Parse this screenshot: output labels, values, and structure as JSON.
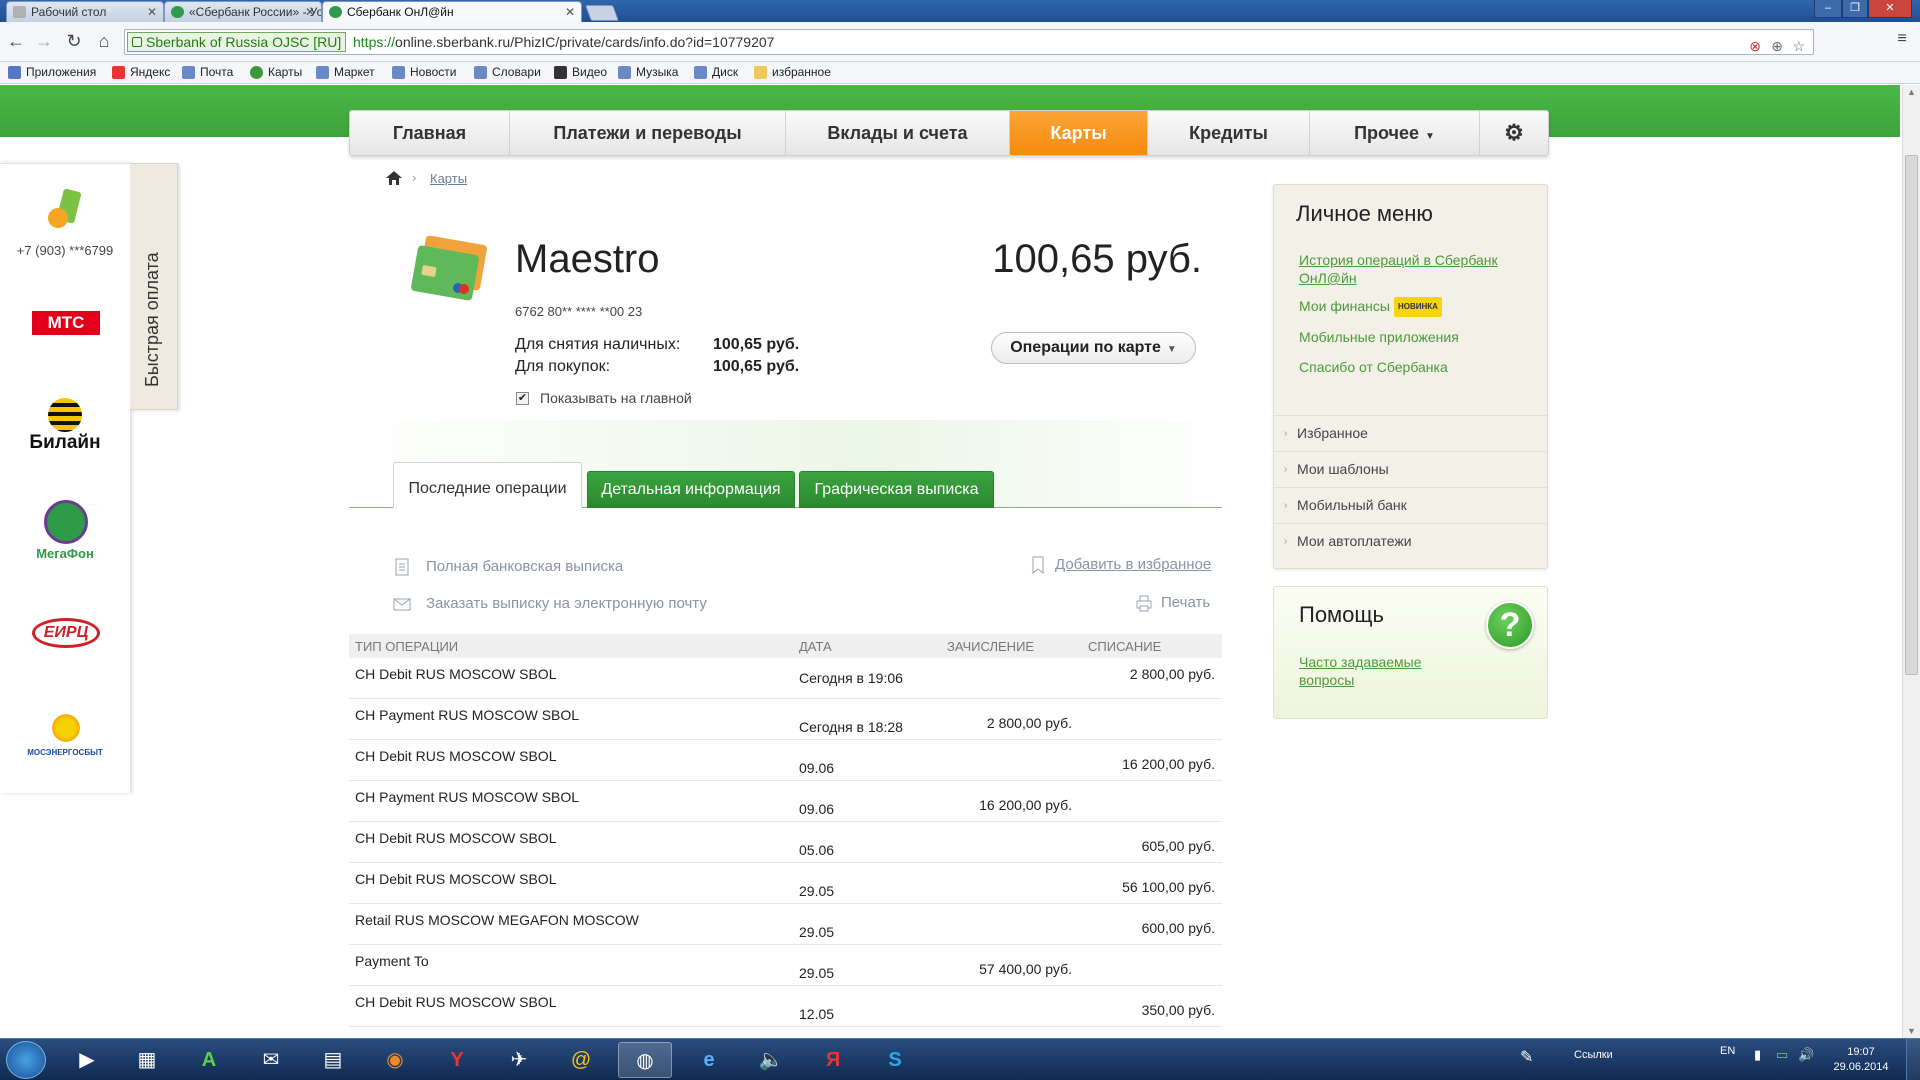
{
  "browser": {
    "tabs": [
      {
        "title": "Рабочий стол",
        "color": "#b0b0b0"
      },
      {
        "title": "«Сбербанк России» - Ус",
        "color": "#2e9b4a"
      },
      {
        "title": "Сбербанк ОнЛ@йн",
        "color": "#2e9b4a"
      }
    ],
    "ev_label": "Sberbank of Russia OJSC [RU]",
    "url_proto": "https://",
    "url_rest": "online.sberbank.ru/PhizIC/private/cards/info.do?id=10779207",
    "bookmarks": [
      "Приложения",
      "Яндекс",
      "Почта",
      "Карты",
      "Маркет",
      "Новости",
      "Словари",
      "Видео",
      "Музыка",
      "Диск",
      "избранное"
    ]
  },
  "nav": {
    "items": [
      "Главная",
      "Платежи и переводы",
      "Вклады и счета",
      "Карты",
      "Кредиты",
      "Прочее"
    ],
    "active": "Карты",
    "accent": "#f68a0c"
  },
  "quickpay": {
    "label": "Быстрая оплата",
    "phone": "+7 (903) ***6799",
    "providers": [
      "МТС",
      "Билайн",
      "МегаФон",
      "ЕИРЦ",
      "МОСЭНЕРГОСБЫТ"
    ]
  },
  "breadcrumb": {
    "current": "Карты"
  },
  "card": {
    "name": "Maestro",
    "balance": "100,65 руб.",
    "number": "6762 80** **** **00 23",
    "cash_label": "Для снятия наличных:",
    "cash_value": "100,65 руб.",
    "purchase_label": "Для покупок:",
    "purchase_value": "100,65 руб.",
    "show_main": "Показывать на главной",
    "show_main_checked": true,
    "ops_button": "Операции по карте"
  },
  "tabs": [
    "Последние операции",
    "Детальная информация",
    "Графическая выписка"
  ],
  "links": {
    "statement": "Полная банковская выписка",
    "email": "Заказать выписку на электронную почту",
    "favorite": "Добавить в избранное",
    "print": "Печать"
  },
  "table": {
    "headers": [
      "ТИП ОПЕРАЦИИ",
      "ДАТА",
      "ЗАЧИСЛЕНИЕ",
      "СПИСАНИЕ"
    ],
    "rows": [
      {
        "op": "CH Debit RUS MOSCOW SBOL",
        "date": "Сегодня в 19:06",
        "credit": "",
        "debit": "2 800,00 руб."
      },
      {
        "op": "CH Payment RUS MOSCOW SBOL",
        "date": "Сегодня в 18:28",
        "credit": "2 800,00 руб.",
        "debit": ""
      },
      {
        "op": "CH Debit RUS MOSCOW SBOL",
        "date": "09.06",
        "credit": "",
        "debit": "16 200,00 руб."
      },
      {
        "op": "CH Payment RUS MOSCOW SBOL",
        "date": "09.06",
        "credit": "16 200,00 руб.",
        "debit": ""
      },
      {
        "op": "CH Debit RUS MOSCOW SBOL",
        "date": "05.06",
        "credit": "",
        "debit": "605,00 руб."
      },
      {
        "op": "CH Debit RUS MOSCOW SBOL",
        "date": "29.05",
        "credit": "",
        "debit": "56 100,00 руб."
      },
      {
        "op": "Retail RUS MOSCOW MEGAFON MOSCOW",
        "date": "29.05",
        "credit": "",
        "debit": "600,00 руб."
      },
      {
        "op": "Payment To",
        "date": "29.05",
        "credit": "57 400,00 руб.",
        "debit": ""
      },
      {
        "op": "CH Debit RUS MOSCOW SBOL",
        "date": "12.05",
        "credit": "",
        "debit": "350,00 руб."
      }
    ]
  },
  "personal_menu": {
    "title": "Личное меню",
    "links": [
      "История операций в Сбербанк ОнЛ@йн",
      "Мои финансы",
      "Мобильные приложения",
      "Спасибо от Сбербанка"
    ],
    "new_badge": "НОВИНКА",
    "items": [
      "Избранное",
      "Мои шаблоны",
      "Мобильный банк",
      "Мои автоплатежи"
    ]
  },
  "help": {
    "title": "Помощь",
    "faq": "Часто задаваемые вопросы"
  },
  "taskbar": {
    "links_label": "Ссылки",
    "lang": "EN",
    "time": "19:07",
    "date": "29.06.2014"
  },
  "colors": {
    "brand_green": "#3ea33b",
    "link_green": "#4b9a3a"
  }
}
